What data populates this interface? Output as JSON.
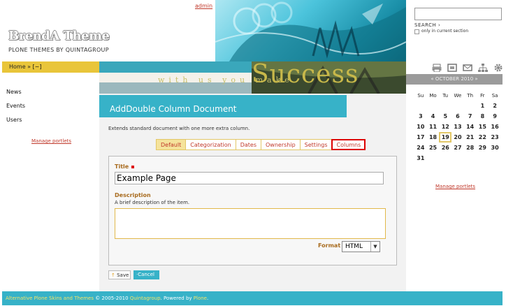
{
  "header": {
    "admin_link": "admin",
    "logo_text": "BrendA Theme",
    "tagline": "PLONE THEMES BY QUINTAGROUP",
    "banner_phrase": "with us you make",
    "banner_word": "Success"
  },
  "breadcrumb": {
    "home": "Home",
    "sep": " » ",
    "current": "[~]"
  },
  "nav": {
    "items": [
      "News",
      "Events",
      "Users"
    ],
    "manage_portlets": "Manage portlets"
  },
  "document": {
    "heading": "AddDouble Column Document",
    "description": "Extends standard document with one more extra column.",
    "tabs": [
      "Default",
      "Categorization",
      "Dates",
      "Ownership",
      "Settings",
      "Columns"
    ],
    "active_tab": "Default",
    "highlighted_tab": "Columns"
  },
  "form": {
    "title_label": "Title",
    "title_value": "Example Page",
    "description_label": "Description",
    "description_help": "A brief description of the item.",
    "description_value": "",
    "format_label": "Format",
    "format_value": "HTML",
    "save_label": "Save",
    "cancel_label": "Cancel"
  },
  "search": {
    "placeholder": "",
    "label": "SEARCH",
    "current_section_label": "only in current section"
  },
  "toolbar_icons": [
    "print-icon",
    "fullscreen-icon",
    "email-icon",
    "sitemap-icon",
    "gear-icon"
  ],
  "calendar": {
    "header": "« OCTOBER 2010 »",
    "weekdays": [
      "Su",
      "Mo",
      "Tu",
      "We",
      "Th",
      "Fr",
      "Sa"
    ],
    "weeks": [
      [
        "",
        "",
        "",
        "",
        "",
        "1",
        "2"
      ],
      [
        "3",
        "4",
        "5",
        "6",
        "7",
        "8",
        "9"
      ],
      [
        "10",
        "11",
        "12",
        "13",
        "14",
        "15",
        "16"
      ],
      [
        "17",
        "18",
        "19",
        "20",
        "21",
        "22",
        "23"
      ],
      [
        "24",
        "25",
        "26",
        "27",
        "28",
        "29",
        "30"
      ],
      [
        "31",
        "",
        "",
        "",
        "",
        "",
        ""
      ]
    ],
    "today": "19",
    "manage_portlets": "Manage portlets"
  },
  "footer": {
    "link1": "Alternative Plone Skins and Themes",
    "copy": " © 2005-2010 ",
    "link2": "Quintagroup",
    "powered": ". Powered by ",
    "link3": "Plone",
    "end": "."
  },
  "colors": {
    "accent": "#37b2c8",
    "breadcrumb_bar": "#e9c53a",
    "link": "#c0392b"
  }
}
